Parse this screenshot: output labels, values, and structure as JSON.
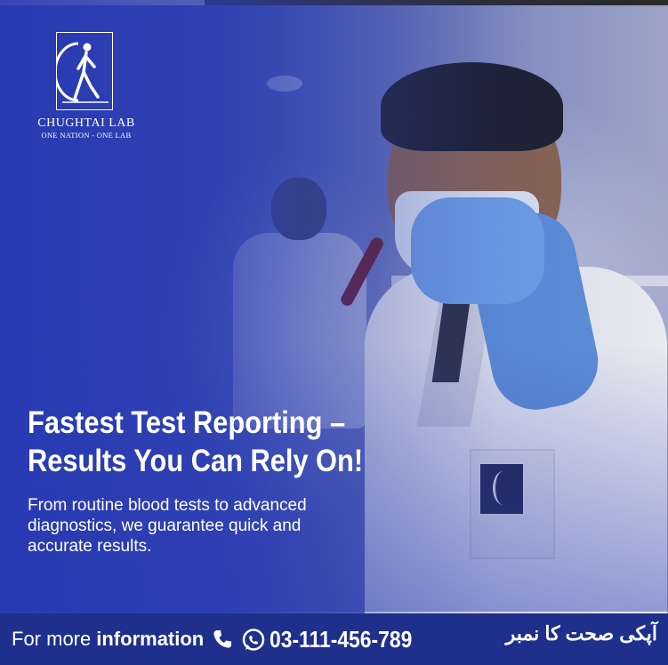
{
  "brand": {
    "name": "CHUGHTAI LAB",
    "tagline": "ONE NATION - ONE LAB"
  },
  "headline": {
    "line1": "Fastest Test Reporting –",
    "line2": "Results You Can Rely On!"
  },
  "subtext": {
    "line1": "From routine blood tests to advanced",
    "line2": "diagnostics, we guarantee quick and",
    "line3": "accurate results."
  },
  "contact": {
    "lead": "For more",
    "lead_bold": "information",
    "phone": "03-111-456-789",
    "urdu_label": "آپکی صحت کا نمبر",
    "icons": [
      "phone-icon",
      "whatsapp-icon"
    ]
  },
  "colors": {
    "brand_blue": "#1e2f8c",
    "overlay_blue": "#2b3fae",
    "text": "#ffffff"
  }
}
